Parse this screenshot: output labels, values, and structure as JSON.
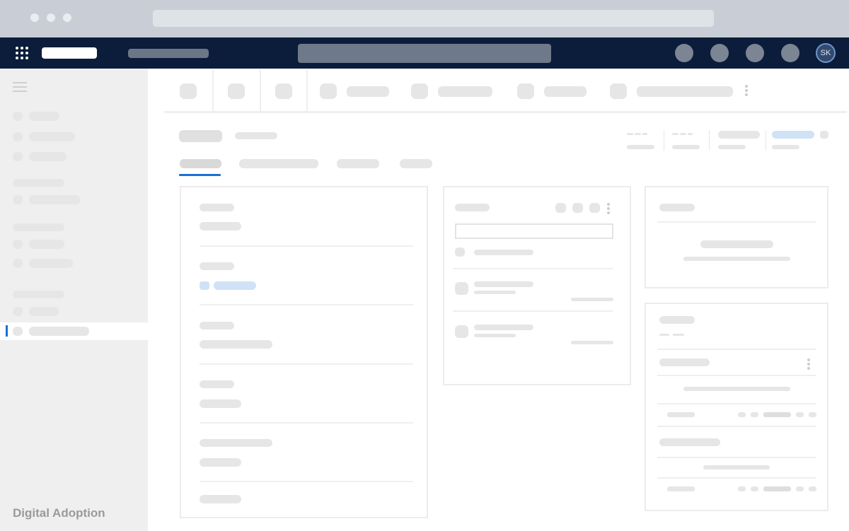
{
  "window": {
    "controls": [
      "close",
      "minimize",
      "maximize"
    ]
  },
  "topnav": {
    "icons": [
      "apps-grid-icon",
      "nav-icon-1",
      "nav-icon-2",
      "nav-icon-3",
      "nav-icon-4"
    ],
    "user_initials": "SK"
  },
  "sidebar": {
    "active_item_index": 9
  },
  "footer": {
    "brand": "Digital Adoption"
  },
  "colors": {
    "chrome": "#c9ced6",
    "topnav": "#0b1d3a",
    "sidebar": "#efefef",
    "accent": "#1a6fd8",
    "skeleton": "#e6e6e6",
    "skeleton_highlight": "#cfe2f6"
  }
}
